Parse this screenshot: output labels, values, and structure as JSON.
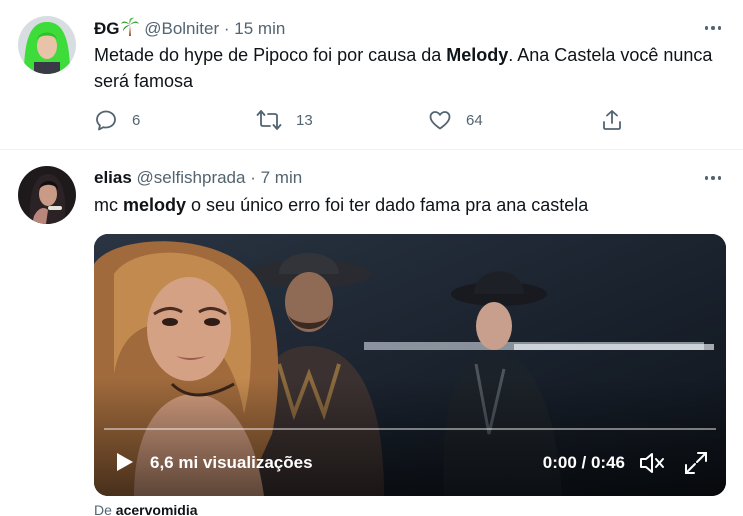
{
  "tweets": [
    {
      "display_name": "ĐG",
      "handle": "@Bolniter",
      "separator": "·",
      "time": "15 min",
      "text_before": "Metade do hype de Pipoco foi por causa da ",
      "text_bold": "Melody",
      "text_after": ". Ana Castela você nunca será famosa",
      "replies": "6",
      "retweets": "13",
      "likes": "64",
      "avatar_color": "#3ddc3a"
    },
    {
      "display_name": "elias",
      "handle": "@selfishprada",
      "separator": "·",
      "time": "7 min",
      "text_before": "mc ",
      "text_bold": "melody",
      "text_after": " o seu único erro foi ter dado fama pra ana castela",
      "video": {
        "views": "6,6 mi visualizações",
        "timecode": "0:00 / 0:46",
        "progress": 0
      },
      "source_prefix": "De",
      "source_name": "acervomidia"
    }
  ],
  "icons": {
    "reply": "reply-icon",
    "retweet": "retweet-icon",
    "like": "heart-icon",
    "share": "share-icon",
    "more": "more-options-icon",
    "play": "play-icon",
    "volume": "volume-icon",
    "fullscreen": "fullscreen-icon",
    "palm": "palm-tree-emoji"
  },
  "colors": {
    "text_primary": "#0f1419",
    "text_secondary": "#536471",
    "divider": "#eff3f4"
  }
}
